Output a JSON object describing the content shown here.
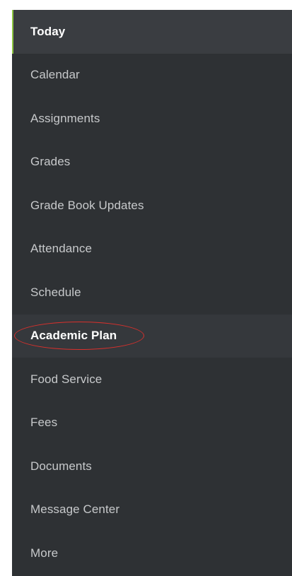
{
  "sidebar": {
    "items": [
      {
        "label": "Today",
        "state": "active"
      },
      {
        "label": "Calendar"
      },
      {
        "label": "Assignments"
      },
      {
        "label": "Grades"
      },
      {
        "label": "Grade Book Updates"
      },
      {
        "label": "Attendance"
      },
      {
        "label": "Schedule"
      },
      {
        "label": "Academic Plan",
        "state": "highlighted"
      },
      {
        "label": "Food Service"
      },
      {
        "label": "Fees"
      },
      {
        "label": "Documents"
      },
      {
        "label": "Message Center"
      },
      {
        "label": "More"
      }
    ]
  },
  "colors": {
    "sidebar_background": "#2e3134",
    "active_indicator": "#8dc63f",
    "annotation_circle": "#d9302c"
  }
}
